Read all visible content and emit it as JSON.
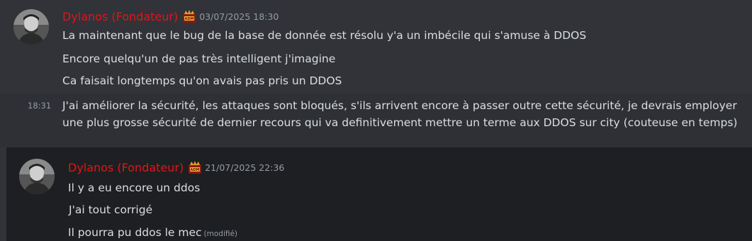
{
  "messages_top": {
    "author": "Dylanos (Fondateur)",
    "badge_icon": "adm-badge-icon",
    "badge_text": "ADM",
    "timestamp": "03/07/2025 18:30",
    "lines": [
      "La maintenant que le bug de la base de donnée est résolu y'a un imbécile qui s'amuse à DDOS",
      "Encore quelqu'un de pas très intelligent j'imagine",
      "Ca faisait longtemps qu'on avais pas pris un DDOS"
    ],
    "followup_time": "18:31",
    "followup_text": "J'ai améliorer la sécurité, les attaques sont bloqués, s'ils arrivent encore à passer outre cette sécurité, je devrais employer une plus grosse sécurité de dernier recours qui va definitivement mettre un terme aux DDOS sur city (couteuse en temps)"
  },
  "messages_bottom": {
    "author": "Dylanos (Fondateur)",
    "badge_icon": "adm-badge-icon",
    "badge_text": "ADM",
    "timestamp": "21/07/2025 22:36",
    "lines": [
      "Il y a eu encore un ddos",
      "J'ai tout corrigé",
      "Il pourra pu ddos le mec"
    ],
    "edited_label": "(modifié)"
  },
  "colors": {
    "username": "#e0151b",
    "timestamp": "#949ba4",
    "text": "#dbdee1",
    "background_top": "#313338",
    "background_bottom": "#1e1f22"
  }
}
